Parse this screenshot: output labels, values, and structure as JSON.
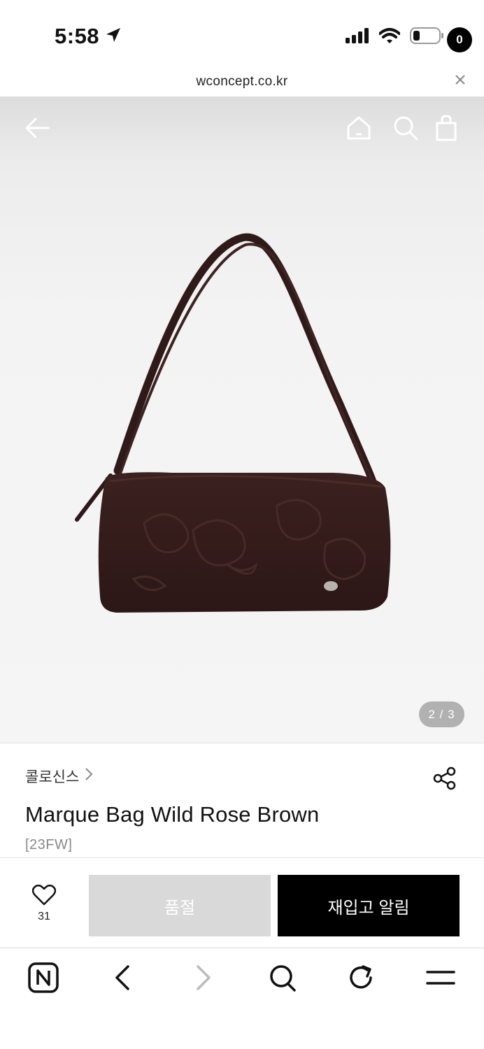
{
  "status_bar": {
    "time": "5:58"
  },
  "browser": {
    "url": "wconcept.co.kr"
  },
  "header": {
    "cart_count": "0"
  },
  "gallery": {
    "pager": "2 / 3"
  },
  "product": {
    "brand": "콜로신스",
    "name": "Marque Bag Wild Rose Brown",
    "season": "[23FW]"
  },
  "actions": {
    "like_count": "31",
    "sold_out_label": "품절",
    "restock_label": "재입고 알림"
  },
  "colors": {
    "accent": "#000000",
    "disabled_button": "#d9d9d9",
    "bag": "#3a1f1d"
  },
  "icons": [
    "location-arrow-icon",
    "signal-icon",
    "wifi-icon",
    "battery-icon",
    "close-icon",
    "back-arrow-icon",
    "home-icon",
    "search-icon",
    "shopping-bag-icon",
    "chevron-right-icon",
    "share-icon",
    "heart-icon",
    "naver-logo-icon",
    "browser-back-icon",
    "browser-forward-icon",
    "browser-search-icon",
    "refresh-icon",
    "menu-icon"
  ]
}
